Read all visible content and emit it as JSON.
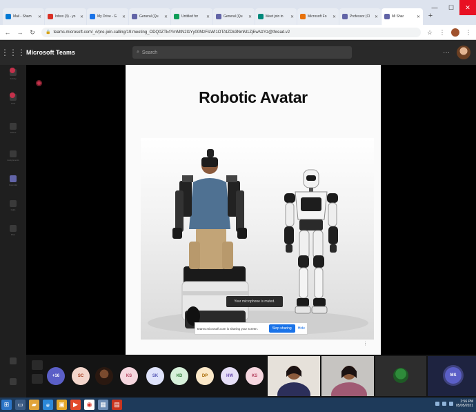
{
  "browser": {
    "tabs": [
      {
        "title": "Mail - Sham",
        "color": "#0078d4"
      },
      {
        "title": "Inbox (3) - yo",
        "color": "#d93025"
      },
      {
        "title": "My Drive - G",
        "color": "#1a73e8"
      },
      {
        "title": "General (Qu",
        "color": "#6264a7"
      },
      {
        "title": "Untitled for",
        "color": "#0f9d58"
      },
      {
        "title": "General (Qu",
        "color": "#6264a7"
      },
      {
        "title": "Meet join in",
        "color": "#00897b"
      },
      {
        "title": "Microsoft Fo",
        "color": "#e8710a"
      },
      {
        "title": "Professor (Cl",
        "color": "#6264a7"
      },
      {
        "title": "Mi Shar",
        "color": "#6264a7",
        "active": true
      }
    ],
    "url": "teams.microsoft.com/_#/pre-join-calling/19:meeting_ODQ0ZTk4YmMtN2I1Yy00MzFiLWI1OTAtZDk3NmM1ZjEwNzYz@thread.v2"
  },
  "teams": {
    "app_title": "Microsoft Teams",
    "search_placeholder": "Search"
  },
  "rail": [
    "Activity",
    "Chat",
    "Teams",
    "Assignments",
    "Calendar",
    "Calls",
    "Files"
  ],
  "slide": {
    "title": "Robotic Avatar"
  },
  "toast": {
    "mic": "Your microphone is muted."
  },
  "sharebar": {
    "message": "teams.microsoft.com is sharing your screen.",
    "stop_label": "Stop sharing",
    "hide_label": "Hide"
  },
  "participants": [
    {
      "initials": "+16",
      "bg": "#5b5fc7",
      "fg": "#ffffff"
    },
    {
      "initials": "SC",
      "bg": "#f3d6cc",
      "fg": "#a43c1e"
    },
    {
      "photo": true
    },
    {
      "initials": "KS",
      "bg": "#f6d7df",
      "fg": "#b23c5a"
    },
    {
      "initials": "SK",
      "bg": "#dfe3fb",
      "fg": "#4f52b2"
    },
    {
      "initials": "KD",
      "bg": "#d7f0da",
      "fg": "#2f7a37"
    },
    {
      "initials": "DP",
      "bg": "#fbe8c8",
      "fg": "#a86a05"
    },
    {
      "initials": "HW",
      "bg": "#e6dff7",
      "fg": "#6a4bb0"
    },
    {
      "initials": "KS",
      "bg": "#f6d7df",
      "fg": "#b23c5a"
    }
  ],
  "big_tile": {
    "initials": "MS"
  },
  "taskbar": {
    "time": "2:56 PM",
    "date": "05/05/2021"
  }
}
